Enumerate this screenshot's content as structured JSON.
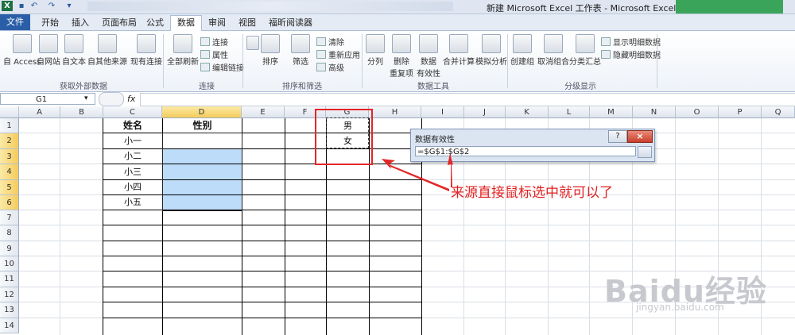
{
  "window": {
    "title": "新建 Microsoft Excel 工作表 - Microsoft Excel",
    "quick_access_icons": [
      "excel-logo-icon",
      "save-icon",
      "undo-icon",
      "redo-icon",
      "customize-icon"
    ]
  },
  "tabs": [
    {
      "label": "文件",
      "active": false,
      "file": true
    },
    {
      "label": "开始",
      "active": false
    },
    {
      "label": "插入",
      "active": false
    },
    {
      "label": "页面布局",
      "active": false
    },
    {
      "label": "公式",
      "active": false
    },
    {
      "label": "数据",
      "active": true
    },
    {
      "label": "审阅",
      "active": false
    },
    {
      "label": "视图",
      "active": false
    },
    {
      "label": "福昕阅读器",
      "active": false
    }
  ],
  "ribbon": {
    "get_external": {
      "group_label": "获取外部数据",
      "buttons": [
        "自 Access",
        "自网站",
        "自文本",
        "自其他来源",
        "现有连接"
      ]
    },
    "connections": {
      "group_label": "连接",
      "refresh": "全部刷新",
      "small": [
        "连接",
        "属性",
        "编辑链接"
      ]
    },
    "sort_filter": {
      "group_label": "排序和筛选",
      "sort": "排序",
      "filter": "筛选",
      "small": [
        "清除",
        "重新应用",
        "高级"
      ]
    },
    "data_tools": {
      "group_label": "数据工具",
      "buttons": [
        "分列",
        "删除\n重复项",
        "数据\n有效性",
        "合并计算",
        "模拟分析"
      ]
    },
    "outline": {
      "group_label": "分级显示",
      "buttons": [
        "创建组",
        "取消组合",
        "分类汇总"
      ],
      "small": [
        "显示明细数据",
        "隐藏明细数据"
      ]
    }
  },
  "formula_bar": {
    "name_box": "G1",
    "fx": "fx",
    "formula": ""
  },
  "columns": [
    "A",
    "B",
    "C",
    "D",
    "E",
    "F",
    "G",
    "H",
    "I",
    "J",
    "K",
    "L",
    "M",
    "N",
    "O",
    "P",
    "Q"
  ],
  "rows": [
    "1",
    "2",
    "3",
    "4",
    "5",
    "6",
    "7",
    "8",
    "9",
    "10",
    "11",
    "12",
    "13",
    "14"
  ],
  "selected_column": "D",
  "selected_rows": [
    "2",
    "3",
    "4",
    "5",
    "6"
  ],
  "cells": {
    "C1": "姓名",
    "D1": "性别",
    "C2": "小一",
    "C3": "小二",
    "C4": "小三",
    "C5": "小四",
    "C6": "小五",
    "G1": "男",
    "G2": "女"
  },
  "dialog": {
    "title": "数据有效性",
    "help": "?",
    "close": "×",
    "value": "=$G$1:$G$2"
  },
  "annotation": "来源直接鼠标选中就可以了",
  "watermark": {
    "brand": "Baidu经验",
    "url": "jingyan.baidu.com"
  }
}
